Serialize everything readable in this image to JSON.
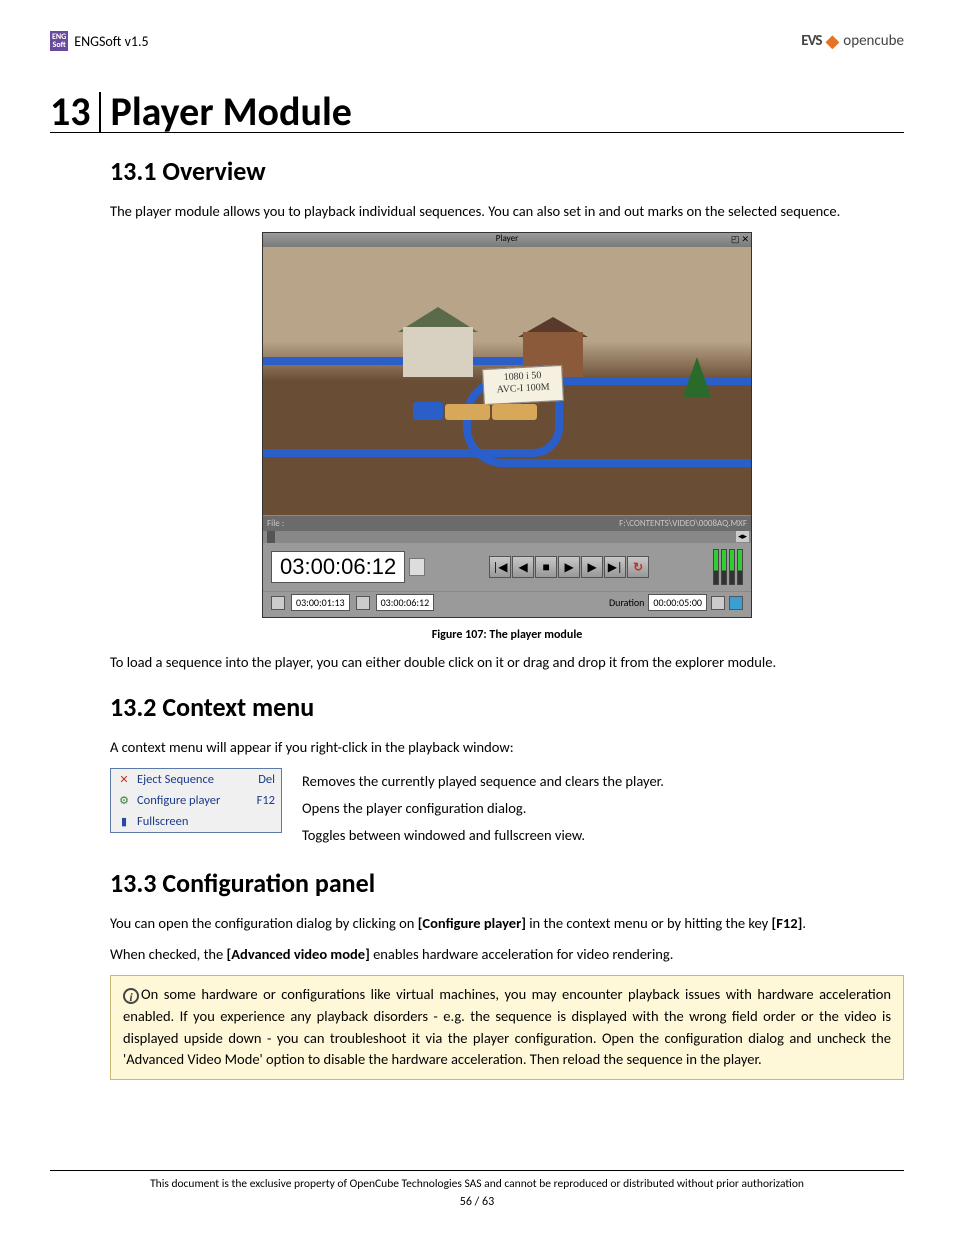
{
  "header": {
    "product": "ENGSoft v1.5",
    "logo_line1": "ENG",
    "logo_line2": "Soft",
    "right_logo1": "EVS",
    "right_logo2": "opencube"
  },
  "chapter": {
    "num": "13",
    "title": "Player Module"
  },
  "s1": {
    "title": "13.1 Overview",
    "p1": "The player module allows you to playback individual sequences. You can also set in and out marks on the selected sequence.",
    "caption": "Figure 107: The player module",
    "p2": "To load a sequence into the player, you can either double click on it or drag and drop it from the explorer module."
  },
  "player": {
    "title": "Player",
    "file_label": "File :",
    "file_path": "F:\\CONTENTS\\VIDEO\\0008AQ.MXF",
    "timecode": "03:00:06:12",
    "in_tc": "03:00:01:13",
    "out_tc": "03:00:06:12",
    "dur_label": "Duration",
    "dur_val": "00:00:05:00",
    "sign_l1": "1080 i 50",
    "sign_l2": "AVC-I  100M"
  },
  "s2": {
    "title": "13.2 Context menu",
    "p1": "A context menu will appear if you right-click in the playback window:",
    "items": [
      {
        "label": "Eject Sequence",
        "key": "Del",
        "icon_color": "#c03020",
        "glyph": "✕"
      },
      {
        "label": "Configure player",
        "key": "F12",
        "icon_color": "#3a7a3a",
        "glyph": "⚙"
      },
      {
        "label": "Fullscreen",
        "key": "",
        "icon_color": "#2a4aa0",
        "glyph": "▮"
      }
    ],
    "descs": [
      "Removes the currently played sequence and clears the player.",
      "Opens the player configuration dialog.",
      "Toggles between windowed and fullscreen view."
    ]
  },
  "s3": {
    "title": "13.3 Configuration panel",
    "p1a": "You can open the configuration dialog by clicking on ",
    "p1b": "[Configure player]",
    "p1c": " in the context menu or by hitting the key ",
    "p1d": "[F12]",
    "p1e": ".",
    "p2a": "When checked, the ",
    "p2b": "[Advanced video mode]",
    "p2c": " enables hardware acceleration for video rendering.",
    "info": "On some hardware or configurations like virtual machines, you may encounter playback issues with hardware acceleration enabled. If you experience any playback disorders - e.g. the sequence is displayed with the wrong field order or the video is displayed upside down - you can troubleshoot it via the player configuration. Open the configuration dialog and uncheck the 'Advanced Video Mode' option to disable the hardware acceleration. Then reload the sequence in the player."
  },
  "footer": {
    "text": "This document is the exclusive property of OpenCube Technologies SAS and cannot be reproduced or distributed without prior authorization",
    "page": "56 / 63"
  }
}
